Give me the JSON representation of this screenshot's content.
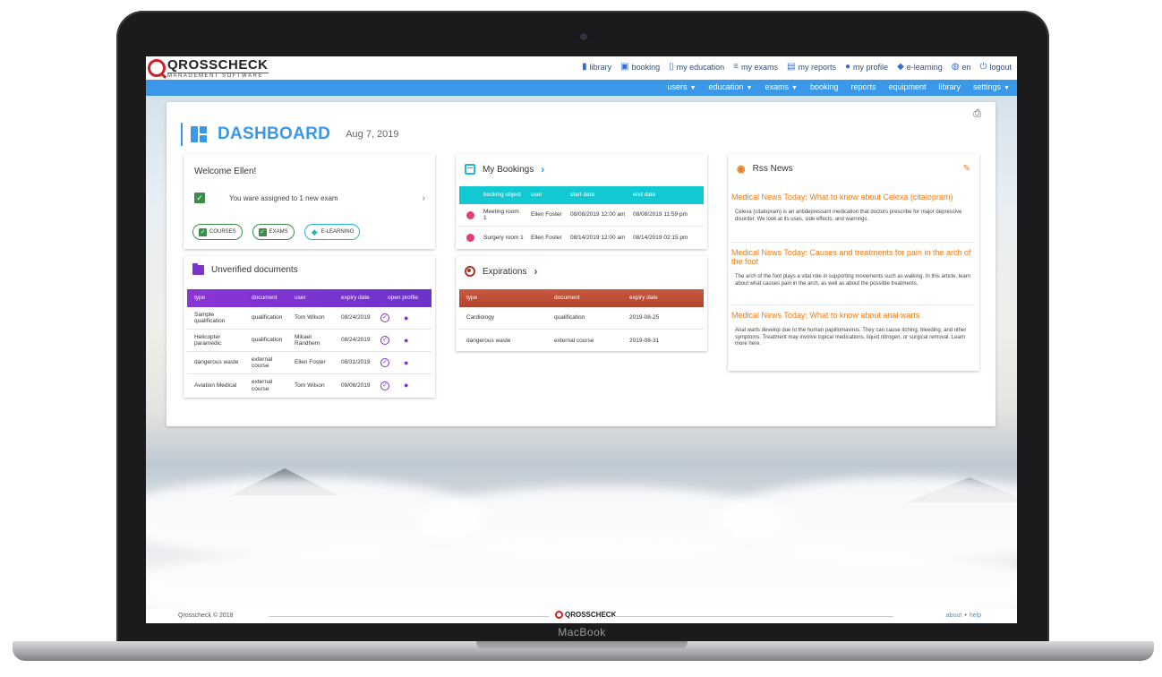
{
  "device": {
    "brand": "MacBook"
  },
  "app": {
    "logo": {
      "name": "QROSSCHECK",
      "subtitle": "MANAGEMENT SOFTWARE"
    },
    "top_links": [
      {
        "label": "library",
        "icon": "book-icon"
      },
      {
        "label": "booking",
        "icon": "calendar-icon"
      },
      {
        "label": "my education",
        "icon": "clipboard-icon"
      },
      {
        "label": "my exams",
        "icon": "checklist-icon"
      },
      {
        "label": "my reports",
        "icon": "document-icon"
      },
      {
        "label": "my profile",
        "icon": "person-icon"
      },
      {
        "label": "e-learning",
        "icon": "graduation-cap-icon"
      },
      {
        "label": "en",
        "icon": "globe-icon"
      },
      {
        "label": "logout",
        "icon": "power-icon"
      }
    ],
    "nav": [
      {
        "label": "users",
        "dropdown": true
      },
      {
        "label": "education",
        "dropdown": true
      },
      {
        "label": "exams",
        "dropdown": true
      },
      {
        "label": "booking",
        "dropdown": false
      },
      {
        "label": "reports",
        "dropdown": false
      },
      {
        "label": "equipment",
        "dropdown": false
      },
      {
        "label": "library",
        "dropdown": false
      },
      {
        "label": "settings",
        "dropdown": true
      }
    ]
  },
  "dashboard": {
    "title": "DASHBOARD",
    "date": "Aug 7, 2019",
    "welcome": {
      "greeting": "Welcome Ellen!",
      "message": "You ware assigned to 1 new exam",
      "buttons": [
        "COURSES",
        "EXAMS",
        "E-LEARNING"
      ]
    },
    "unverified": {
      "title": "Unverified documents",
      "columns": [
        "type",
        "document",
        "user",
        "expiry date",
        "open profile"
      ],
      "rows": [
        {
          "type": "Sample qualification",
          "document": "qualification",
          "user": "Tom Wilson",
          "expiry": "08/24/2019"
        },
        {
          "type": "Helicopter paramedic",
          "document": "qualification",
          "user": "Mikael Randhem",
          "expiry": "08/24/2019"
        },
        {
          "type": "dangerous waste",
          "document": "external course",
          "user": "Ellen Foster",
          "expiry": "08/31/2019"
        },
        {
          "type": "Aviation Medical",
          "document": "external course",
          "user": "Tom Wilson",
          "expiry": "09/06/2019"
        }
      ]
    },
    "bookings": {
      "title": "My Bookings",
      "columns": [
        "booking object",
        "user",
        "start date",
        "end date"
      ],
      "rows": [
        {
          "object": "Meeting room 1",
          "user": "Ellen Foster",
          "start": "08/08/2019 12:00 am",
          "end": "08/08/2019 11:59 pm"
        },
        {
          "object": "Surgery room 1",
          "user": "Ellen Foster",
          "start": "08/14/2019 12:00 am",
          "end": "08/14/2019 02:15 pm"
        }
      ],
      "dot_color": "#e73b7a"
    },
    "expirations": {
      "title": "Expirations",
      "columns": [
        "type",
        "document",
        "expiry date"
      ],
      "rows": [
        {
          "type": "Cardiology",
          "document": "qualification",
          "expiry": "2019-08-25"
        },
        {
          "type": "dangerous waste",
          "document": "external course",
          "expiry": "2019-08-31"
        }
      ]
    },
    "rss": {
      "title": "Rss News",
      "items": [
        {
          "headline": "Medical News Today: What to know about Celexa (citalopram)",
          "description": "Celexa (citalopram) is an antidepressant medication that doctors prescribe for major depressive disorder. We look at its uses, side effects, and warnings."
        },
        {
          "headline": "Medical News Today: Causes and treatments for pain in the arch of the foot",
          "description": "The arch of the foot plays a vital role in supporting movements such as walking. In this article, learn about what causes pain in the arch, as well as about the possible treatments."
        },
        {
          "headline": "Medical News Today: What to know about anal warts",
          "description": "Anal warts develop due to the human papillomavirus. They can cause itching, bleeding, and other symptoms. Treatment may involve topical medications, liquid nitrogen, or surgical removal. Learn more here."
        }
      ]
    }
  },
  "footer": {
    "copyright": "Qrosscheck © 2018",
    "logo": "QROSSCHECK",
    "about": "about",
    "separator": "•",
    "help": "help"
  },
  "colors": {
    "primary": "#3b97e8",
    "purple": "#7b34c9",
    "teal": "#12c9d3",
    "rust": "#b2432e",
    "orange": "#f07a16",
    "green": "#3a8d4b"
  }
}
